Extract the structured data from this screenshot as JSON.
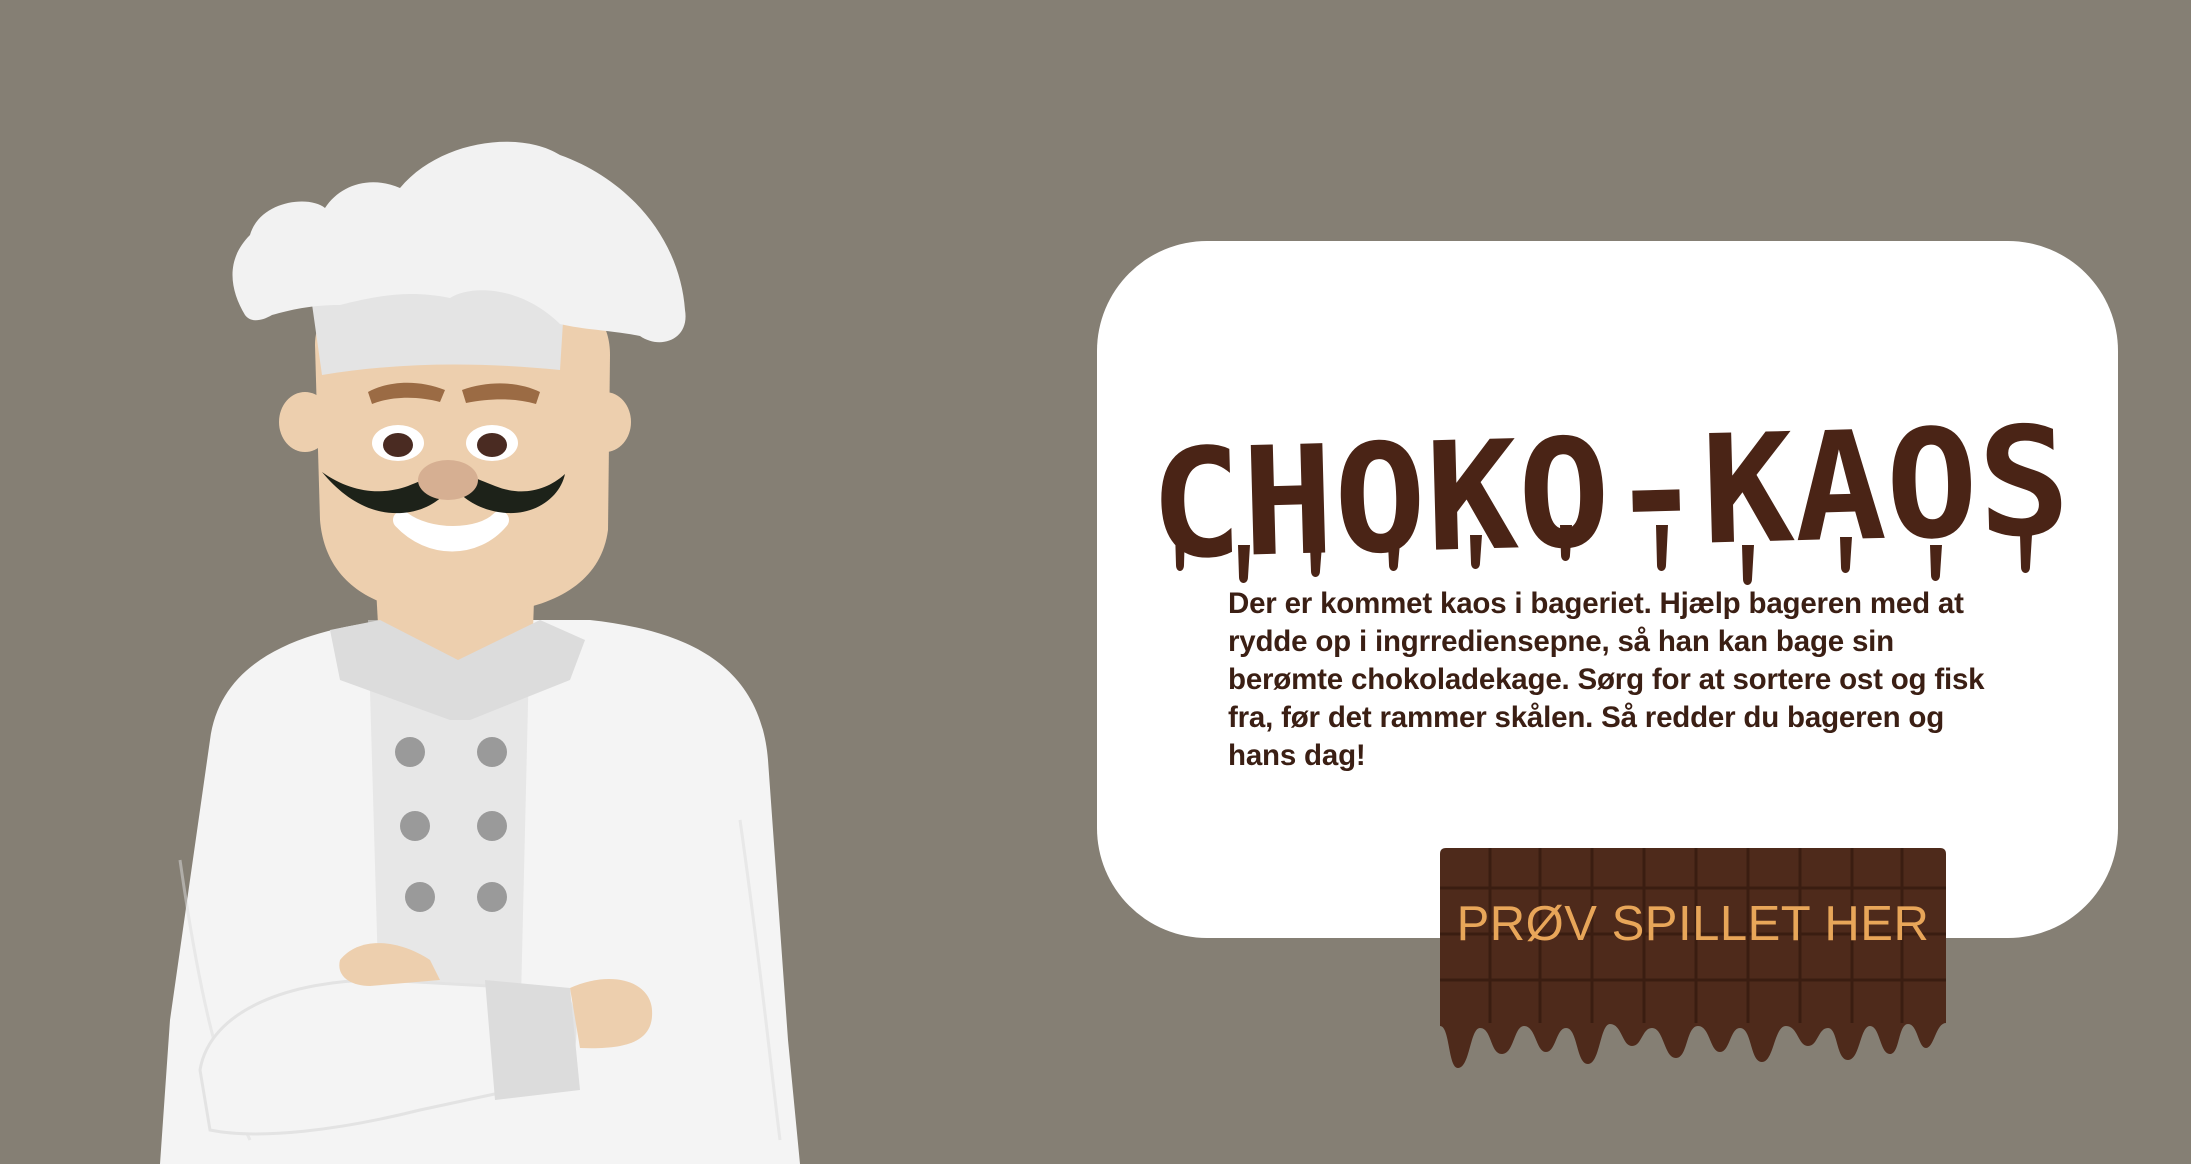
{
  "page": {
    "background_color": "#857f74"
  },
  "chef": {
    "icon": "chef-illustration",
    "colors": {
      "hat": "#f2f2f2",
      "hat_band": "#e4e4e4",
      "skin": "#edcfae",
      "nose": "#d6af92",
      "eyebrow": "#9b6b44",
      "pupil": "#4a2b22",
      "mustache": "#1d2219",
      "jacket": "#f4f4f4",
      "jacket_shade": "#dcdcdc",
      "button": "#9a9a9a"
    }
  },
  "card": {
    "background_color": "#ffffff",
    "title": "CHOKO-KAOS",
    "title_color": "#4a2416",
    "intro_text": "Der er kommet kaos i bageriet. Hjælp bageren med at rydde op i ingrrediensерne, så han kan bage sin berømte chokoladekage. Sørg for at sortere ost og fisk fra, før det rammer skålen. Så redder du bageren og hans dag!",
    "intro_color": "#3b1f14"
  },
  "cta": {
    "label": "PRØV SPILLET HER",
    "label_color": "#e8a659",
    "chocolate_color": "#4e2a1b",
    "chocolate_dark": "#3a1d11",
    "chocolate_light": "#6a3a22"
  }
}
